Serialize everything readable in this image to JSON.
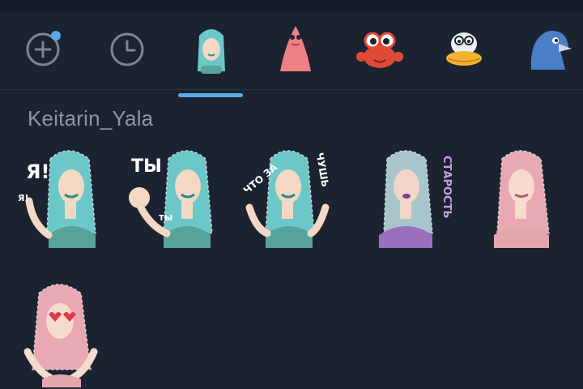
{
  "tabs": [
    {
      "name": "add-pack",
      "icon": "plus-circle-icon",
      "badge": true
    },
    {
      "name": "recent",
      "icon": "clock-icon"
    },
    {
      "name": "keitarin-yala",
      "icon": "girl-sticker-icon",
      "active": true
    },
    {
      "name": "pink-cone",
      "icon": "pink-character-icon"
    },
    {
      "name": "crab",
      "icon": "crab-icon"
    },
    {
      "name": "duck",
      "icon": "duck-icon"
    },
    {
      "name": "blue-bird",
      "icon": "blue-bird-icon"
    }
  ],
  "pack": {
    "title": "Keitarin_Yala"
  },
  "stickers": [
    {
      "hair": "#6cc7c9",
      "shirt": "#58a39a",
      "caption": "Я!",
      "caption2": "Я!"
    },
    {
      "hair": "#6cc7c9",
      "shirt": "#58a39a",
      "caption": "ТЫ",
      "caption2": "ТЫ"
    },
    {
      "hair": "#6cc7c9",
      "shirt": "#58a39a",
      "caption": "ЧТО ЗА",
      "caption2": "ЧУШЬ"
    },
    {
      "hair": "#a9c5cc",
      "shirt": "#9a6fbd",
      "caption": "СТАРОСТЬ"
    },
    {
      "hair": "#e9a9b4",
      "shirt": "#e2a6ad",
      "caption": ""
    },
    {
      "hair": "#e9a9b4",
      "shirt": "#e2a6ad",
      "caption": ""
    }
  ],
  "colors": {
    "background": "#1b2330",
    "accent": "#5aa9e6",
    "text_muted": "#8b96a5",
    "icon_gray": "#7a8595"
  }
}
